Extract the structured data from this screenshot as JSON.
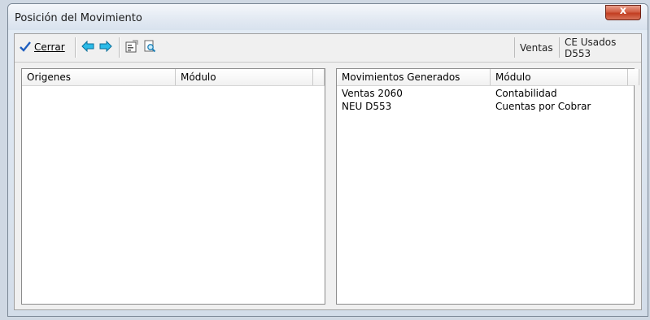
{
  "window": {
    "title": "Posición del Movimiento",
    "close_glyph": "x"
  },
  "toolbar": {
    "close_label": "Cerrar",
    "status": [
      "Ventas",
      "CE Usados D553"
    ]
  },
  "left_grid": {
    "columns": [
      "Origenes",
      "Módulo"
    ],
    "rows": []
  },
  "right_grid": {
    "columns": [
      "Movimientos Generados",
      "Módulo"
    ],
    "rows": [
      [
        "Ventas 2060",
        "Contabilidad"
      ],
      [
        "NEU D553",
        "Cuentas por Cobrar"
      ]
    ]
  },
  "colors": {
    "accent": "#1f5fbf",
    "arrow": "#2bbbe8"
  },
  "icons": [
    "check-icon",
    "arrow-left-icon",
    "arrow-right-icon",
    "properties-icon",
    "search-document-icon",
    "close-icon"
  ]
}
